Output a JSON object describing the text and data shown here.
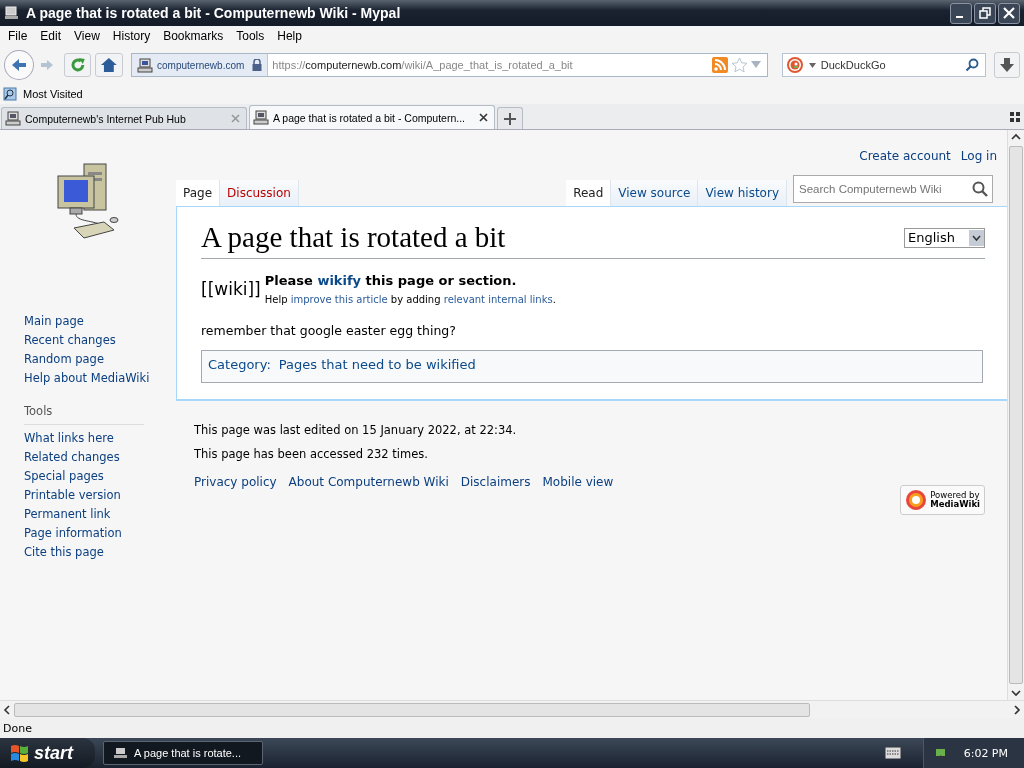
{
  "window": {
    "title": "A page that is rotated a bit - Computernewb Wiki - Mypal"
  },
  "menu": [
    "File",
    "Edit",
    "View",
    "History",
    "Bookmarks",
    "Tools",
    "Help"
  ],
  "toolbar": {
    "site_identity": "computernewb.com",
    "url": {
      "scheme": "https://",
      "host": "computernewb.com",
      "path": "/wiki/A_page_that_is_rotated_a_bit"
    },
    "search": {
      "placeholder": "DuckDuckGo"
    }
  },
  "bookmarks": [
    "Most Visited"
  ],
  "tabs": [
    {
      "label": "Computernewb's Internet Pub Hub",
      "selected": false
    },
    {
      "label": "A page that is rotated a bit - Computern...",
      "selected": true
    }
  ],
  "wiki": {
    "personal_links": [
      "Create account",
      "Log in"
    ],
    "namespace_tabs": [
      {
        "label": "Page",
        "selected": true,
        "missing": false
      },
      {
        "label": "Discussion",
        "selected": false,
        "missing": true
      }
    ],
    "view_tabs": [
      {
        "label": "Read",
        "selected": true
      },
      {
        "label": "View source",
        "selected": false
      },
      {
        "label": "View history",
        "selected": false
      }
    ],
    "search": {
      "placeholder": "Search Computernewb Wiki"
    },
    "title": "A page that is rotated a bit",
    "language": "English",
    "notice": {
      "badge": "[[wiki]]",
      "heading": [
        {
          "text": "Please ",
          "kind": "text"
        },
        {
          "text": "wikify",
          "kind": "link"
        },
        {
          "text": " this page or section.",
          "kind": "text"
        }
      ],
      "detail": [
        {
          "text": "Help ",
          "kind": "text"
        },
        {
          "text": "improve this article",
          "kind": "link"
        },
        {
          "text": " by adding ",
          "kind": "text"
        },
        {
          "text": "relevant internal links",
          "kind": "link"
        },
        {
          "text": ".",
          "kind": "text"
        }
      ]
    },
    "body": "remember that google easter egg thing?",
    "category_label": "Category:",
    "categories": [
      "Pages that need to be wikified"
    ],
    "navigation": [
      "Main page",
      "Recent changes",
      "Random page",
      "Help about MediaWiki"
    ],
    "tools_heading": "Tools",
    "tools": [
      "What links here",
      "Related changes",
      "Special pages",
      "Printable version",
      "Permanent link",
      "Page information",
      "Cite this page"
    ],
    "footer_info": [
      "This page was last edited on 15 January 2022, at 22:34.",
      "This page has been accessed 232 times."
    ],
    "footer_links": [
      "Privacy policy",
      "About Computernewb Wiki",
      "Disclaimers",
      "Mobile view"
    ],
    "powered_by": [
      "Powered by",
      "MediaWiki"
    ]
  },
  "status_bar": "Done",
  "taskbar": {
    "start": "start",
    "tasks": [
      {
        "label": "A page that is rotate...",
        "selected": true
      }
    ],
    "clock": "6:02 PM"
  }
}
